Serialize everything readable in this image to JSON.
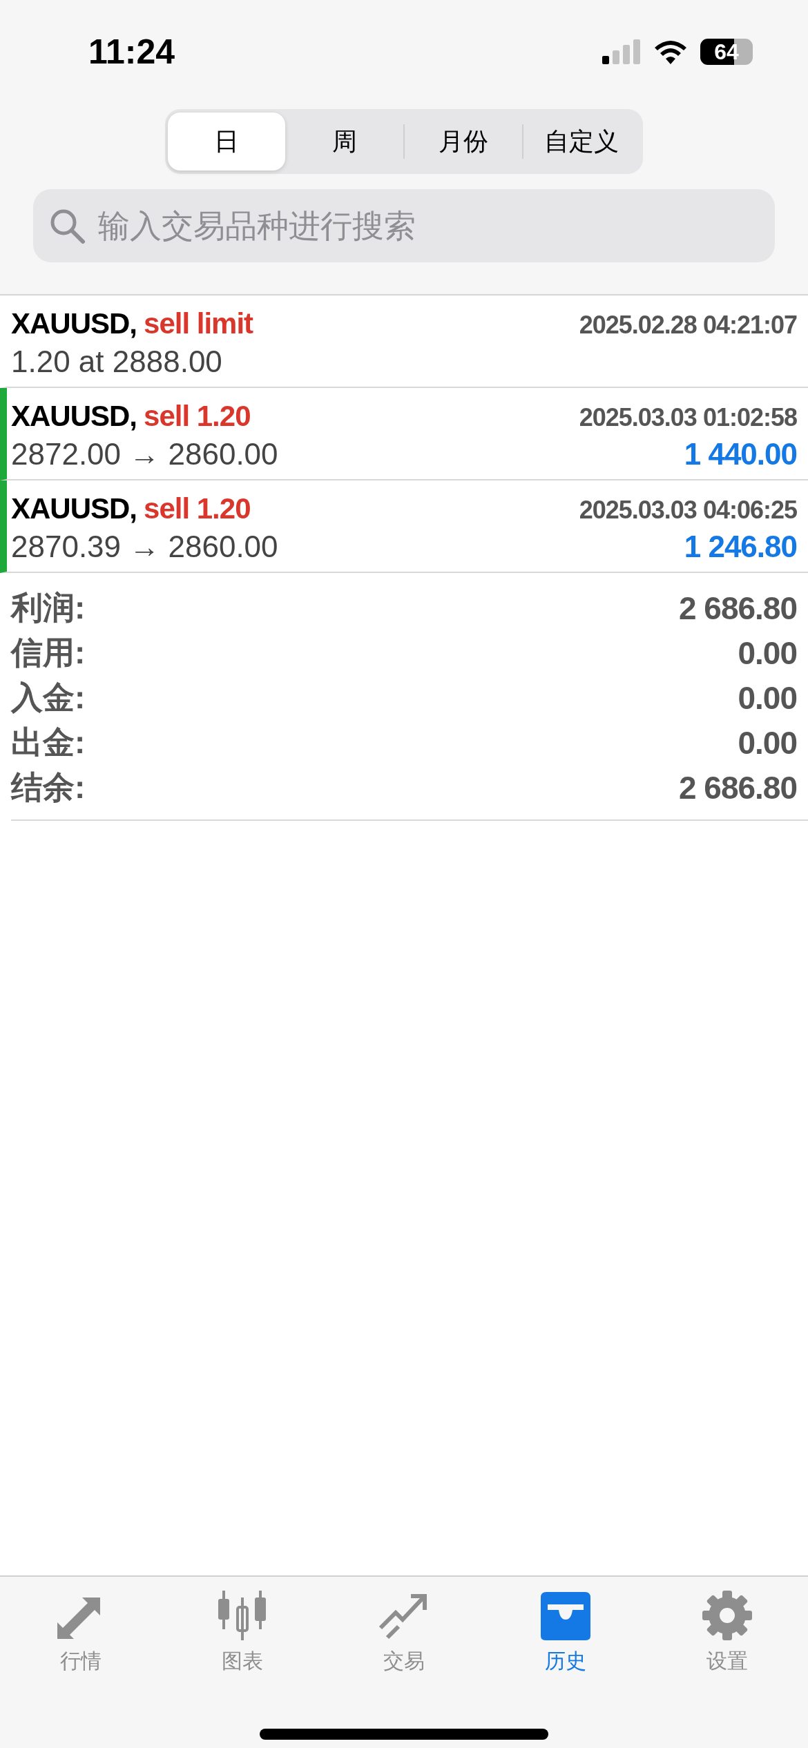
{
  "status_bar": {
    "time": "11:24",
    "battery": "64"
  },
  "period_tabs": [
    {
      "label": "日",
      "selected": true
    },
    {
      "label": "周",
      "selected": false
    },
    {
      "label": "月份",
      "selected": false
    },
    {
      "label": "自定义",
      "selected": false
    }
  ],
  "search": {
    "placeholder": "输入交易品种进行搜索"
  },
  "trades": [
    {
      "kind": "order",
      "symbol": "XAUUSD,",
      "action": "sell limit",
      "time": "2025.02.28 04:21:07",
      "detail": "1.20 at 2888.00"
    },
    {
      "kind": "deal",
      "symbol": "XAUUSD,",
      "action": "sell 1.20",
      "time": "2025.03.03 01:02:58",
      "detail": "2872.00 → 2860.00",
      "profit": "1 440.00"
    },
    {
      "kind": "deal",
      "symbol": "XAUUSD,",
      "action": "sell 1.20",
      "time": "2025.03.03 04:06:25",
      "detail": "2870.39 → 2860.00",
      "profit": "1 246.80"
    }
  ],
  "summary": [
    {
      "label": "利润:",
      "value": "2 686.80"
    },
    {
      "label": "信用:",
      "value": "0.00"
    },
    {
      "label": "入金:",
      "value": "0.00"
    },
    {
      "label": "出金:",
      "value": "0.00"
    },
    {
      "label": "结余:",
      "value": "2 686.80"
    }
  ],
  "tab_bar": [
    {
      "label": "行情",
      "selected": false
    },
    {
      "label": "图表",
      "selected": false
    },
    {
      "label": "交易",
      "selected": false
    },
    {
      "label": "历史",
      "selected": true
    },
    {
      "label": "设置",
      "selected": false
    }
  ]
}
